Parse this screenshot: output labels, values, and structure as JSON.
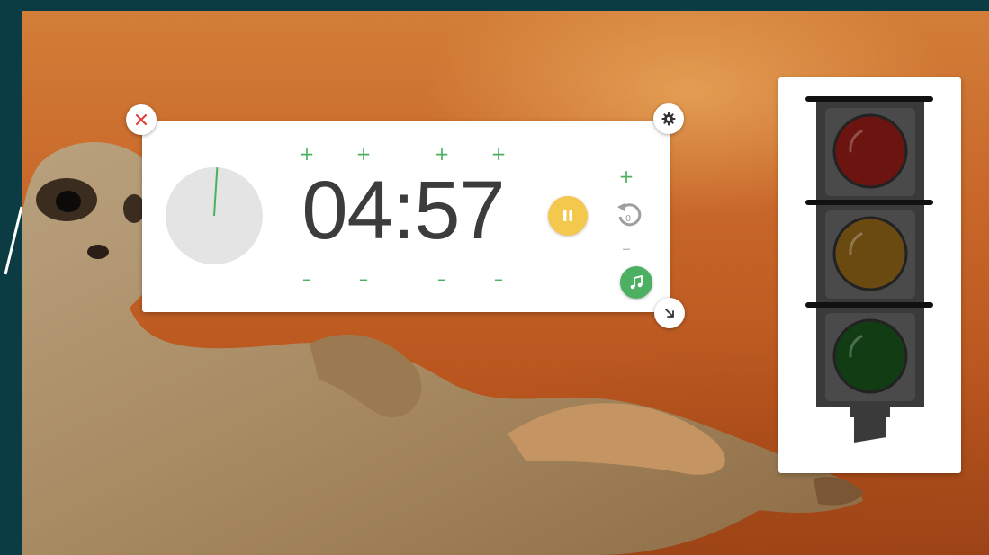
{
  "timer": {
    "display": "04:57",
    "elapsed_fraction": 0.01,
    "state": "running",
    "increment_symbol": "+",
    "decrement_symbol": "–",
    "colors": {
      "accent": "#4caf62",
      "pause": "#f2c94c",
      "close": "#e53935",
      "dial": "#e4e4e4"
    }
  },
  "traffic_light": {
    "lamps": [
      {
        "color": "red",
        "hex": "#6b1410",
        "lit": false
      },
      {
        "color": "amber",
        "hex": "#6b4a12",
        "lit": false
      },
      {
        "color": "green",
        "hex": "#123d14",
        "lit": false
      }
    ]
  },
  "icons": [
    "close-icon",
    "gear-icon",
    "resize-icon",
    "pause-icon",
    "reset-icon",
    "music-icon"
  ]
}
